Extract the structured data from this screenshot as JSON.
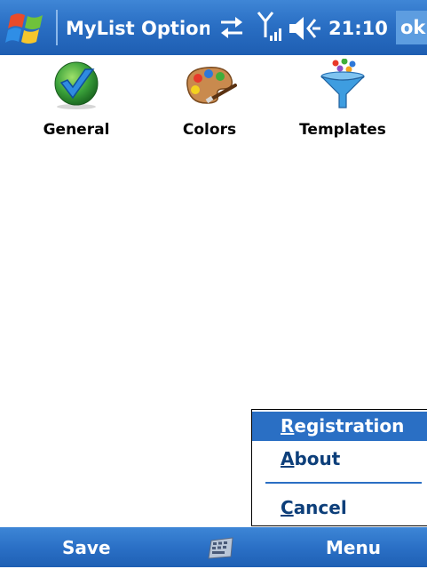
{
  "titlebar": {
    "title": "MyList Options",
    "time": "21:10",
    "ok_label": "ok",
    "icons": [
      "windows-start-icon",
      "connectivity-icon",
      "signal-icon",
      "volume-icon"
    ]
  },
  "options": [
    {
      "label": "General",
      "icon": "general-checkmark-icon"
    },
    {
      "label": "Colors",
      "icon": "palette-icon"
    },
    {
      "label": "Templates",
      "icon": "funnel-icon"
    }
  ],
  "menu": {
    "items": [
      {
        "label": "Registration",
        "hotkey": "R",
        "rest": "egistration",
        "selected": true
      },
      {
        "label": "About",
        "hotkey": "A",
        "rest": "bout",
        "selected": false
      },
      {
        "label": "Cancel",
        "hotkey": "C",
        "rest": "ancel",
        "selected": false
      }
    ]
  },
  "softkeys": {
    "left": "Save",
    "right": "Menu",
    "center_icon": "keyboard-icon"
  },
  "colors": {
    "accent": "#2a6fc4",
    "menu_text": "#0d3f7a",
    "ok_highlight": "#5d9de0"
  }
}
